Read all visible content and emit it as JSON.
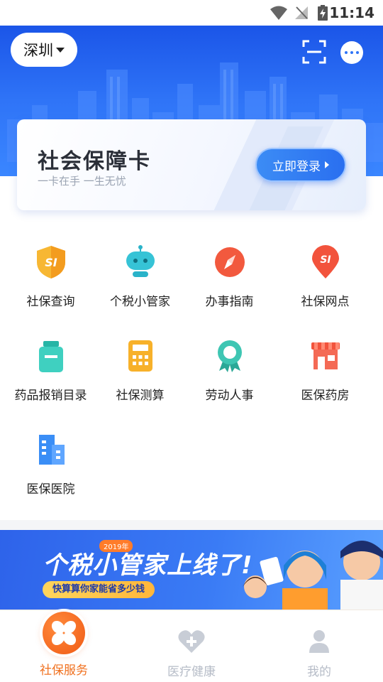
{
  "status_bar": {
    "time": "11:14"
  },
  "header": {
    "city": "深圳"
  },
  "card": {
    "title": "社会保障卡",
    "subtitle": "一卡在手 一生无忧",
    "login_label": "立即登录"
  },
  "services": [
    {
      "label": "社保查询",
      "icon": "shield-si-icon"
    },
    {
      "label": "个税小管家",
      "icon": "robot-icon"
    },
    {
      "label": "办事指南",
      "icon": "compass-icon"
    },
    {
      "label": "社保网点",
      "icon": "location-pin-icon"
    },
    {
      "label": "药品报销目录",
      "icon": "medicine-bottle-icon"
    },
    {
      "label": "社保测算",
      "icon": "calculator-icon"
    },
    {
      "label": "劳动人事",
      "icon": "badge-medal-icon"
    },
    {
      "label": "医保药房",
      "icon": "pharmacy-store-icon"
    },
    {
      "label": "医保医院",
      "icon": "hospital-building-icon"
    }
  ],
  "banner": {
    "year": "2019年",
    "headline": "个税小管家上线了!",
    "pill": "快算算你家能省多少钱"
  },
  "bottom_nav": [
    {
      "label": "社保服务",
      "active": true
    },
    {
      "label": "医疗健康",
      "active": false
    },
    {
      "label": "我的",
      "active": false
    }
  ],
  "colors": {
    "primary_blue": "#2f74f7",
    "active_orange": "#f0701e",
    "inactive_gray": "#b6bcc7"
  }
}
